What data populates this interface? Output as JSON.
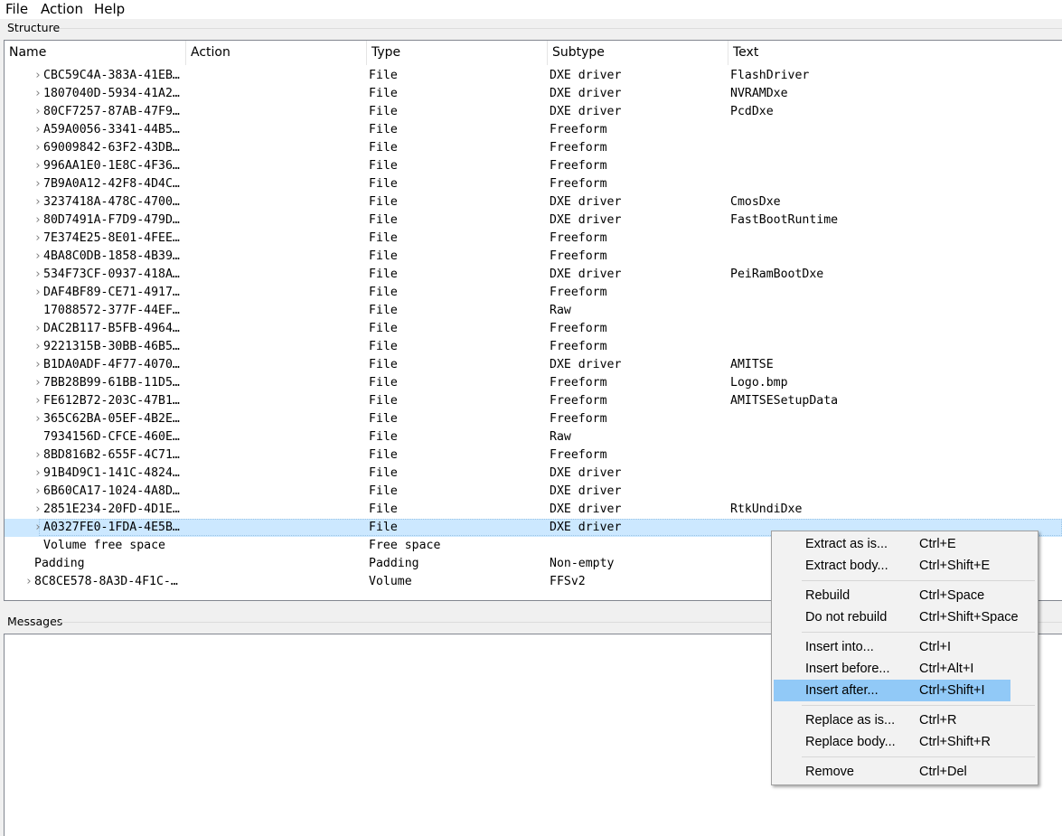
{
  "menubar": {
    "file": "File",
    "action": "Action",
    "help": "Help"
  },
  "structure": {
    "label": "Structure",
    "columns": [
      "Name",
      "Action",
      "Type",
      "Subtype",
      "Text"
    ],
    "rows": [
      {
        "name": "CBC59C4A-383A-41EB…",
        "type": "File",
        "subtype": "DXE driver",
        "text": "FlashDriver",
        "expander": true,
        "indent": 1
      },
      {
        "name": "1807040D-5934-41A2…",
        "type": "File",
        "subtype": "DXE driver",
        "text": "NVRAMDxe",
        "expander": true,
        "indent": 1
      },
      {
        "name": "80CF7257-87AB-47F9…",
        "type": "File",
        "subtype": "DXE driver",
        "text": "PcdDxe",
        "expander": true,
        "indent": 1
      },
      {
        "name": "A59A0056-3341-44B5…",
        "type": "File",
        "subtype": "Freeform",
        "text": "",
        "expander": true,
        "indent": 1
      },
      {
        "name": "69009842-63F2-43DB…",
        "type": "File",
        "subtype": "Freeform",
        "text": "",
        "expander": true,
        "indent": 1
      },
      {
        "name": "996AA1E0-1E8C-4F36…",
        "type": "File",
        "subtype": "Freeform",
        "text": "",
        "expander": true,
        "indent": 1
      },
      {
        "name": "7B9A0A12-42F8-4D4C…",
        "type": "File",
        "subtype": "Freeform",
        "text": "",
        "expander": true,
        "indent": 1
      },
      {
        "name": "3237418A-478C-4700…",
        "type": "File",
        "subtype": "DXE driver",
        "text": "CmosDxe",
        "expander": true,
        "indent": 1
      },
      {
        "name": "80D7491A-F7D9-479D…",
        "type": "File",
        "subtype": "DXE driver",
        "text": "FastBootRuntime",
        "expander": true,
        "indent": 1
      },
      {
        "name": "7E374E25-8E01-4FEE…",
        "type": "File",
        "subtype": "Freeform",
        "text": "",
        "expander": true,
        "indent": 1
      },
      {
        "name": "4BA8C0DB-1858-4B39…",
        "type": "File",
        "subtype": "Freeform",
        "text": "",
        "expander": true,
        "indent": 1
      },
      {
        "name": "534F73CF-0937-418A…",
        "type": "File",
        "subtype": "DXE driver",
        "text": "PeiRamBootDxe",
        "expander": true,
        "indent": 1
      },
      {
        "name": "DAF4BF89-CE71-4917…",
        "type": "File",
        "subtype": "Freeform",
        "text": "",
        "expander": true,
        "indent": 1
      },
      {
        "name": "17088572-377F-44EF…",
        "type": "File",
        "subtype": "Raw",
        "text": "",
        "expander": false,
        "indent": 1
      },
      {
        "name": "DAC2B117-B5FB-4964…",
        "type": "File",
        "subtype": "Freeform",
        "text": "",
        "expander": true,
        "indent": 1
      },
      {
        "name": "9221315B-30BB-46B5…",
        "type": "File",
        "subtype": "Freeform",
        "text": "",
        "expander": true,
        "indent": 1
      },
      {
        "name": "B1DA0ADF-4F77-4070…",
        "type": "File",
        "subtype": "DXE driver",
        "text": "AMITSE",
        "expander": true,
        "indent": 1
      },
      {
        "name": "7BB28B99-61BB-11D5…",
        "type": "File",
        "subtype": "Freeform",
        "text": "Logo.bmp",
        "expander": true,
        "indent": 1
      },
      {
        "name": "FE612B72-203C-47B1…",
        "type": "File",
        "subtype": "Freeform",
        "text": "AMITSESetupData",
        "expander": true,
        "indent": 1
      },
      {
        "name": "365C62BA-05EF-4B2E…",
        "type": "File",
        "subtype": "Freeform",
        "text": "",
        "expander": true,
        "indent": 1
      },
      {
        "name": "7934156D-CFCE-460E…",
        "type": "File",
        "subtype": "Raw",
        "text": "",
        "expander": false,
        "indent": 1
      },
      {
        "name": "8BD816B2-655F-4C71…",
        "type": "File",
        "subtype": "Freeform",
        "text": "",
        "expander": true,
        "indent": 1
      },
      {
        "name": "91B4D9C1-141C-4824…",
        "type": "File",
        "subtype": "DXE driver",
        "text": "",
        "expander": true,
        "indent": 1
      },
      {
        "name": "6B60CA17-1024-4A8D…",
        "type": "File",
        "subtype": "DXE driver",
        "text": "",
        "expander": true,
        "indent": 1
      },
      {
        "name": "2851E234-20FD-4D1E…",
        "type": "File",
        "subtype": "DXE driver",
        "text": "RtkUndiDxe",
        "expander": true,
        "indent": 1
      },
      {
        "name": "A0327FE0-1FDA-4E5B…",
        "type": "File",
        "subtype": "DXE driver",
        "text": "",
        "expander": true,
        "indent": 1,
        "selected": true
      },
      {
        "name": "Volume free space",
        "type": "Free space",
        "subtype": "",
        "text": "",
        "expander": false,
        "indent": 1
      },
      {
        "name": "Padding",
        "type": "Padding",
        "subtype": "Non-empty",
        "text": "",
        "expander": false,
        "indent": 0
      },
      {
        "name": "8C8CE578-8A3D-4F1C-…",
        "type": "Volume",
        "subtype": "FFSv2",
        "text": "",
        "expander": true,
        "indent": 0
      }
    ]
  },
  "messages": {
    "label": "Messages"
  },
  "context_menu": {
    "groups": [
      [
        {
          "label": "Extract as is...",
          "shortcut": "Ctrl+E"
        },
        {
          "label": "Extract body...",
          "shortcut": "Ctrl+Shift+E"
        }
      ],
      [
        {
          "label": "Rebuild",
          "shortcut": "Ctrl+Space"
        },
        {
          "label": "Do not rebuild",
          "shortcut": "Ctrl+Shift+Space"
        }
      ],
      [
        {
          "label": "Insert into...",
          "shortcut": "Ctrl+I"
        },
        {
          "label": "Insert before...",
          "shortcut": "Ctrl+Alt+I"
        },
        {
          "label": "Insert after...",
          "shortcut": "Ctrl+Shift+I",
          "highlighted": true
        }
      ],
      [
        {
          "label": "Replace as is...",
          "shortcut": "Ctrl+R"
        },
        {
          "label": "Replace body...",
          "shortcut": "Ctrl+Shift+R"
        }
      ],
      [
        {
          "label": "Remove",
          "shortcut": "Ctrl+Del"
        }
      ]
    ]
  },
  "colors": {
    "selection": "#cce8ff",
    "menu_highlight": "#91c9f7",
    "border": "#828790"
  }
}
